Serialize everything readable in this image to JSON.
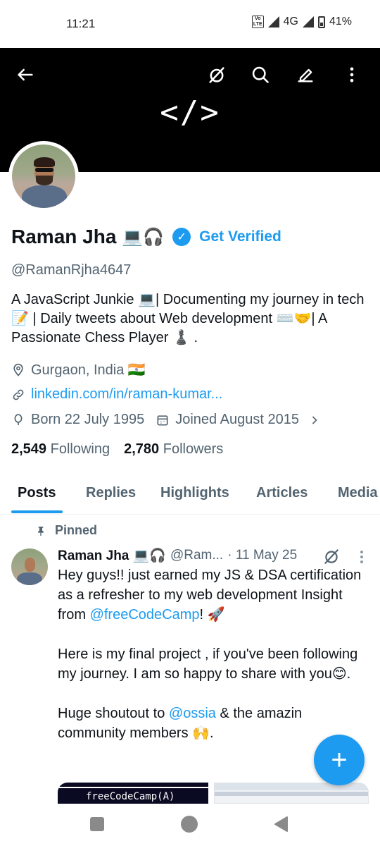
{
  "status_bar": {
    "time": "11:21",
    "volte": "Vo LTE",
    "network": "4G",
    "battery": "41%"
  },
  "banner": {
    "code_text": "</>",
    "background": "#000000"
  },
  "toolbar": {
    "icons": [
      "back-arrow-icon",
      "grok-icon",
      "search-icon",
      "edit-icon",
      "more-vertical-icon"
    ]
  },
  "profile": {
    "name": "Raman Jha",
    "name_emoji": "💻🎧",
    "get_verified": "Get Verified",
    "handle": "@RamanRjha4647",
    "bio": "A JavaScript Junkie 💻| Documenting my journey in tech 📝 | Daily tweets about Web development ⌨️🤝| A Passionate Chess Player ♟️ .",
    "location": "Gurgaon, India 🇮🇳",
    "website": "linkedin.com/in/raman-kumar...",
    "born": "Born 22 July 1995",
    "joined": "Joined August 2015",
    "following_count": "2,549",
    "following_label": "Following",
    "followers_count": "2,780",
    "followers_label": "Followers"
  },
  "tabs": [
    {
      "label": "Posts",
      "active": true
    },
    {
      "label": "Replies",
      "active": false
    },
    {
      "label": "Highlights",
      "active": false
    },
    {
      "label": "Articles",
      "active": false
    },
    {
      "label": "Media",
      "active": false
    }
  ],
  "pinned_post": {
    "pinned_label": "Pinned",
    "author_name": "Raman Jha 💻🎧",
    "author_handle": "@Ram...",
    "date": "· 11 May 25",
    "line1_prefix": "Hey guys!! just earned my JS & DSA certification as a refresher to my web development Insight from ",
    "line1_mention": "@freeCodeCamp",
    "line1_suffix": "! 🚀",
    "para2": "Here is my final project , if you've been following my journey. I am so happy to share with you😊.",
    "para3_prefix": "Huge shoutout to ",
    "para3_mention": "@ossia",
    "para3_suffix": " & the amazin",
    "para3_line2": "community members 🙌.",
    "media_text": "freeCodeCamp(A)"
  },
  "fab": {
    "label": "+"
  },
  "colors": {
    "accent": "#1d9bf0",
    "text_primary": "#0f1419",
    "text_secondary": "#536471"
  }
}
